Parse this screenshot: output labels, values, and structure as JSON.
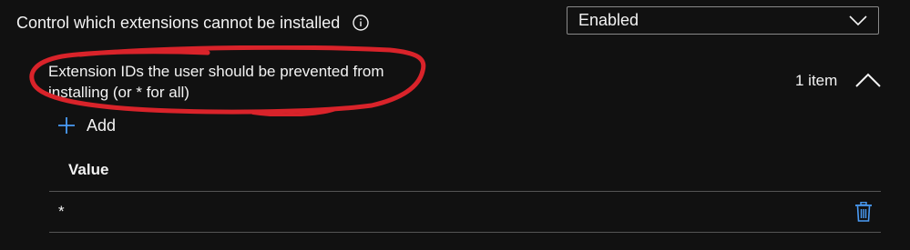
{
  "setting": {
    "label": "Control which extensions cannot be installed",
    "info_icon": "info-icon",
    "dropdown_value": "Enabled",
    "dropdown_icon": "chevron-down-icon"
  },
  "extension_list": {
    "description": "Extension IDs the user should be prevented from installing (or * for all)",
    "item_count": "1 item",
    "collapse_icon": "chevron-up-icon",
    "add_label": "Add",
    "add_icon": "plus-icon",
    "column_header": "Value",
    "rows": [
      {
        "value": "*",
        "delete_icon": "trash-icon"
      }
    ]
  },
  "colors": {
    "background": "#111111",
    "text": "#f3f3f3",
    "accent": "#4a9cf6",
    "annotation": "#d9232a",
    "divider": "#555555",
    "dropdown_border": "#8a8a8a"
  }
}
